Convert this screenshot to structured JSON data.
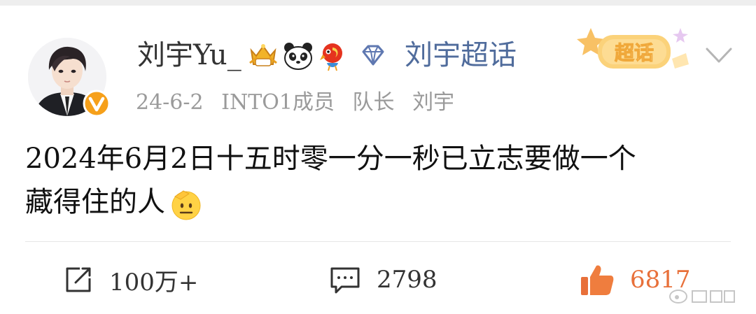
{
  "post": {
    "author": {
      "name": "刘宇Yu_"
    },
    "topic_link": "刘宇超话",
    "supertopic_badge": "超话",
    "meta": {
      "date": "24-6-2",
      "title": "INTO1成员",
      "role": "队长",
      "name": "刘宇"
    },
    "text_line1": "2024年6月2日十五时零一分一秒已立志要做一个",
    "text_line2": "藏得住的人",
    "emoji": "saluting-face"
  },
  "actions": {
    "repost_count": "100万+",
    "comment_count": "2798",
    "like_count": "6817"
  },
  "colors": {
    "link": "#506c9c",
    "like": "#e8703a",
    "meta": "#9a9a9a",
    "text": "#111111"
  },
  "icons": [
    "verified-v-icon",
    "crown-rank-badge-icon",
    "panda-icon",
    "parrot-icon",
    "diamond-icon",
    "chevron-down-icon",
    "repost-icon",
    "comment-icon",
    "thumbs-up-icon"
  ]
}
